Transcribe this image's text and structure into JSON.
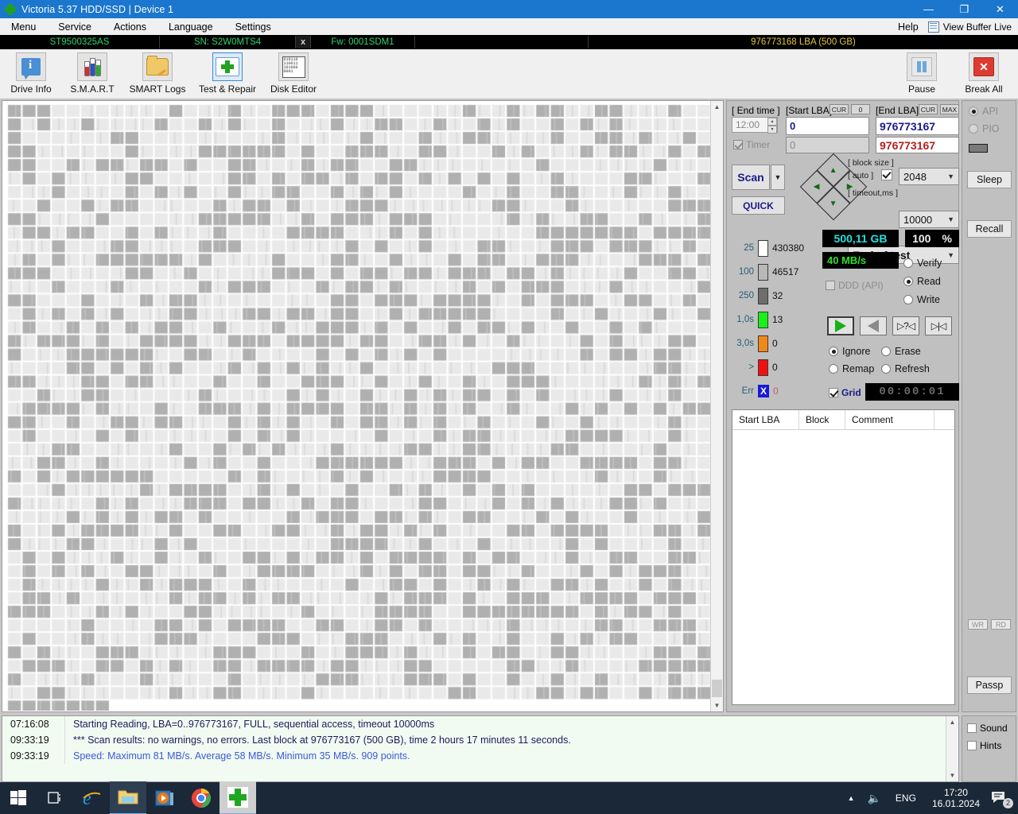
{
  "window": {
    "title": "Victoria 5.37 HDD/SSD | Device 1",
    "icon": "green-cross-icon",
    "minimize": "—",
    "maximize": "❐",
    "close": "✕"
  },
  "menubar": {
    "items": [
      {
        "label": "Menu"
      },
      {
        "label": "Service"
      },
      {
        "label": "Actions"
      },
      {
        "label": "Language"
      },
      {
        "label": "Settings"
      }
    ],
    "help": "Help",
    "view_buffer": "View Buffer Live"
  },
  "drivebar": {
    "model": "ST9500325AS",
    "serial": "SN: S2W0MTS4",
    "close_drive": "x",
    "firmware": "Fw: 0001SDM1",
    "capacity": "976773168 LBA (500 GB)"
  },
  "toolbar": {
    "buttons": [
      {
        "label": "Drive Info",
        "icon": "info-icon",
        "selected": false
      },
      {
        "label": "S.M.A.R.T",
        "icon": "test-tubes-icon",
        "selected": false
      },
      {
        "label": "SMART Logs",
        "icon": "folder-pencil-icon",
        "selected": false
      },
      {
        "label": "Test & Repair",
        "icon": "first-aid-kit-icon",
        "selected": true
      },
      {
        "label": "Disk Editor",
        "icon": "binary-page-icon",
        "selected": false
      }
    ],
    "disk_editor_bits": "010110 110011 101000 0001",
    "pause": "Pause",
    "break_all": "Break All"
  },
  "scan_params": {
    "end_time_label": "[ End time ]",
    "end_time_value": "12:00",
    "timer_label": "Timer",
    "timer_checked": true,
    "timer_value": "0",
    "start_lba_label": "[Start LBA]",
    "start_lba_cur": "CUR",
    "start_lba_zero": "0",
    "start_lba_value": "0",
    "end_lba_label": "[End LBA]",
    "end_lba_cur": "CUR",
    "end_lba_max": "MAX",
    "end_lba_value": "976773167",
    "end_lba_value2": "976773167",
    "scan_button": "Scan",
    "quick_button": "QUICK",
    "block_size_label": "[ block size ]",
    "auto_label": "[ auto ]",
    "auto_checked": true,
    "block_size_value": "2048",
    "timeout_label": "[ timeout,ms ]",
    "timeout_value": "10000",
    "end_action_value": "End of test"
  },
  "legend": {
    "rows": [
      {
        "name": "25",
        "color": "#ffffff",
        "count": "430380"
      },
      {
        "name": "100",
        "color": "#b8b8b8",
        "count": "46517"
      },
      {
        "name": "250",
        "color": "#6e6e6e",
        "count": "32"
      },
      {
        "name": "1,0s",
        "color": "#18f018",
        "count": "13"
      },
      {
        "name": "3,0s",
        "color": "#f08818",
        "count": "0"
      },
      {
        "name": ">",
        "color": "#f01010",
        "count": "0"
      },
      {
        "name": "Err",
        "color": "#1818d8",
        "count": "0"
      }
    ]
  },
  "status": {
    "capacity_done": "500,11 GB",
    "percent": "100",
    "percent_unit": "%",
    "speed": "40 MB/s",
    "ddd_api_label": "DDD (API)",
    "ddd_checked": false,
    "mode_options": [
      "Verify",
      "Read",
      "Write"
    ],
    "mode_selected": "Read",
    "transport_buttons": [
      "play-forward-icon",
      "play-reverse-icon",
      "seek-unknown-icon",
      "seek-start-icon"
    ],
    "defect_options": [
      "Ignore",
      "Erase",
      "Remap",
      "Refresh"
    ],
    "defect_selected": "Ignore",
    "grid_label": "Grid",
    "grid_checked": true,
    "elapsed": "00:00:01"
  },
  "sector_table": {
    "columns": [
      "Start LBA",
      "Block",
      "Comment"
    ],
    "rows": []
  },
  "sidebar": {
    "api_label": "API",
    "pio_label": "PIO",
    "api_selected": true,
    "sleep": "Sleep",
    "recall": "Recall",
    "wr": "WR",
    "rd": "RD",
    "passport": "Passp"
  },
  "log": {
    "entries": [
      {
        "time": "07:16:08",
        "text": "Starting Reading, LBA=0..976773167, FULL, sequential access, timeout 10000ms",
        "color": "#1a1a5a"
      },
      {
        "time": "09:33:19",
        "text": "*** Scan results: no warnings, no errors. Last block at 976773167 (500 GB), time 2 hours 17 minutes 11 seconds.",
        "color": "#1a1a5a"
      },
      {
        "time": "09:33:19",
        "text": "Speed: Maximum 81 MB/s. Average 58 MB/s. Minimum 35 MB/s. 909 points.",
        "color": "#3a5ad8"
      }
    ],
    "sound_label": "Sound",
    "hints_label": "Hints",
    "sound_checked": false,
    "hints_checked": false
  },
  "taskbar": {
    "items": [
      {
        "name": "start-button",
        "icon": "windows-logo-icon"
      },
      {
        "name": "task-view-button",
        "icon": "task-view-icon"
      },
      {
        "name": "internet-explorer-button",
        "icon": "internet-explorer-icon"
      },
      {
        "name": "file-explorer-button",
        "icon": "folder-icon"
      },
      {
        "name": "media-player-button",
        "icon": "media-player-icon"
      },
      {
        "name": "chrome-button",
        "icon": "chrome-icon"
      },
      {
        "name": "victoria-button",
        "icon": "green-cross-icon"
      }
    ],
    "language": "ENG",
    "time": "17:20",
    "date": "16.01.2024",
    "notification_count": "2"
  },
  "map": {
    "cell_light": "#e9e9e9",
    "cell_mid": "#b0b0b0",
    "cols": 48,
    "rows": 45,
    "filled_cells": 2119
  }
}
